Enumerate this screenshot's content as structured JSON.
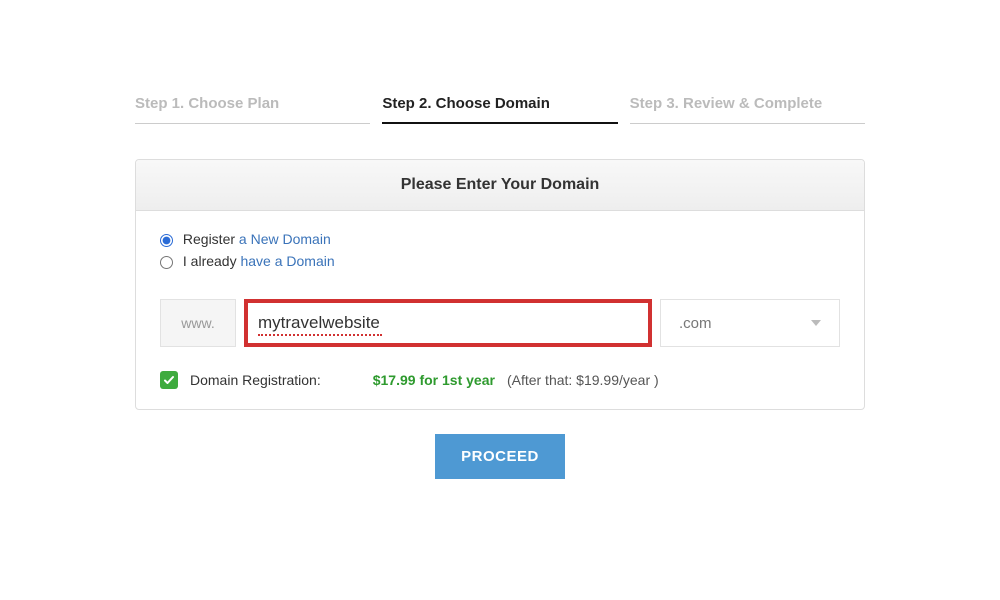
{
  "steps": [
    {
      "label": "Step 1. Choose Plan"
    },
    {
      "label": "Step 2. Choose Domain"
    },
    {
      "label": "Step 3. Review & Complete"
    }
  ],
  "card": {
    "title": "Please Enter Your Domain",
    "option_register_prefix": "Register",
    "option_register_link": " a New Domain",
    "option_have_prefix": "I already",
    "option_have_link": " have a Domain",
    "www": "www.",
    "domain_value": "mytravelwebsite",
    "tld": ".com",
    "registration_label": "Domain Registration:",
    "price_first": "$17.99 for 1st year",
    "price_after": "(After that: $19.99/year )",
    "proceed": "PROCEED"
  }
}
